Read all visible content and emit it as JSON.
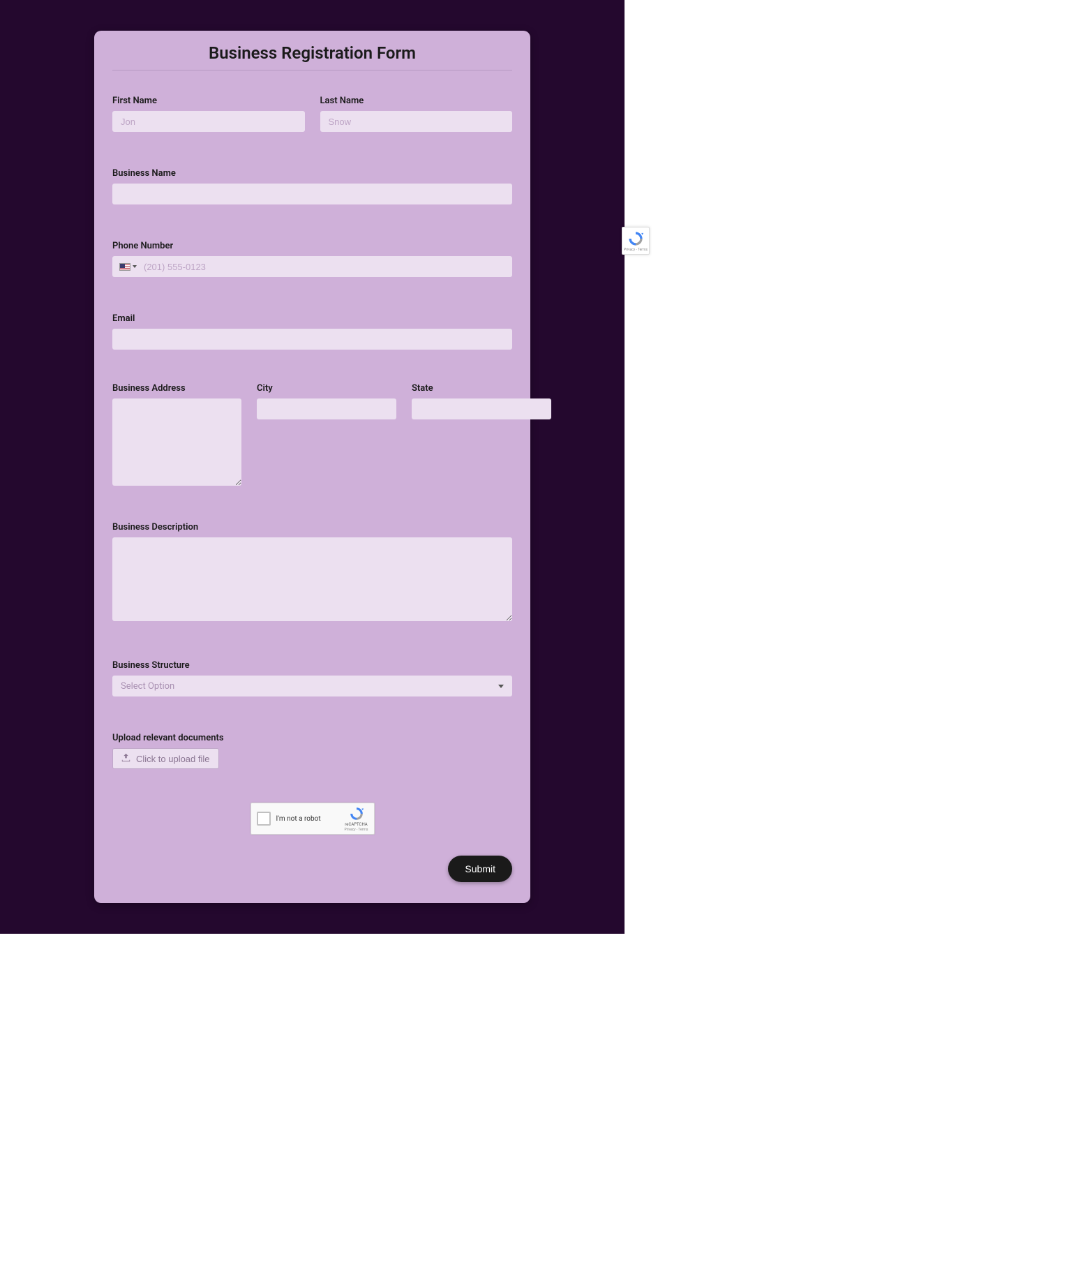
{
  "form": {
    "title": "Business Registration Form",
    "firstName": {
      "label": "First Name",
      "placeholder": "Jon"
    },
    "lastName": {
      "label": "Last Name",
      "placeholder": "Snow"
    },
    "businessName": {
      "label": "Business Name"
    },
    "phone": {
      "label": "Phone Number",
      "placeholder": "(201) 555-0123",
      "country": "US"
    },
    "email": {
      "label": "Email"
    },
    "businessAddress": {
      "label": "Business Address"
    },
    "city": {
      "label": "City"
    },
    "state": {
      "label": "State"
    },
    "businessDescription": {
      "label": "Business Description"
    },
    "businessStructure": {
      "label": "Business Structure",
      "placeholder": "Select Option"
    },
    "upload": {
      "label": "Upload relevant documents",
      "button": "Click to upload file"
    },
    "recaptcha": {
      "label": "I'm not a robot",
      "brand": "reCAPTCHA",
      "terms": "Privacy - Terms"
    },
    "submit": "Submit"
  }
}
